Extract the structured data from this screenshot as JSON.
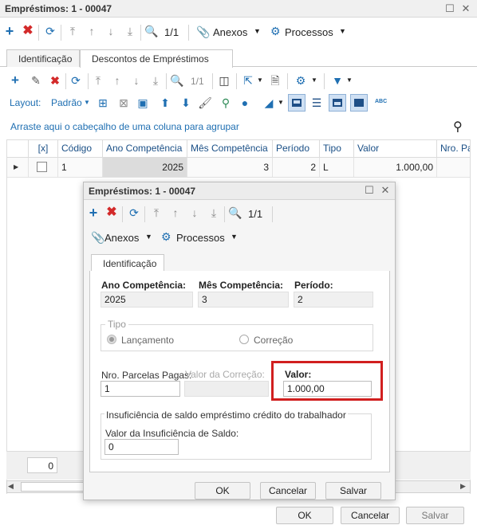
{
  "main": {
    "title": "Empréstimos: 1 - 00047",
    "toolbar": {
      "page": "1/1",
      "anexos": "Anexos",
      "processos": "Processos"
    },
    "tabs": [
      "Identificação",
      "Descontos de Empréstimos"
    ],
    "grid_toolbar": {
      "page": "1/1",
      "layout_label": "Layout:",
      "layout_value": "Padrão",
      "abc": "ABC"
    },
    "group_hint": "Arraste aqui o cabeçalho de uma coluna para agrupar",
    "columns": [
      "[x]",
      "Código",
      "Ano Competência",
      "Mês Competência",
      "Período",
      "Tipo",
      "Valor",
      "Nro. Pa"
    ],
    "row": {
      "codigo": "1",
      "ano": "2025",
      "mes": "3",
      "periodo": "2",
      "tipo": "L",
      "valor": "1.000,00"
    },
    "footer_count": "0",
    "buttons": {
      "ok": "OK",
      "cancel": "Cancelar",
      "save": "Salvar"
    }
  },
  "dialog": {
    "title": "Empréstimos: 1 - 00047",
    "toolbar": {
      "page": "1/1",
      "anexos": "Anexos",
      "processos": "Processos"
    },
    "tab": "Identificação",
    "fields": {
      "ano_label": "Ano Competência:",
      "ano": "2025",
      "mes_label": "Mês Competência:",
      "mes": "3",
      "periodo_label": "Período:",
      "periodo": "2"
    },
    "tipo": {
      "legend": "Tipo",
      "opt1": "Lançamento",
      "opt2": "Correção"
    },
    "parcelas_label": "Nro. Parcelas Pagas:",
    "parcelas": "1",
    "correcao_label": "Valor da Correção:",
    "valor_label": "Valor:",
    "valor": "1.000,00",
    "insuf": {
      "legend": "Insuficiência de saldo empréstimo crédito do trabalhador",
      "label": "Valor da Insuficiência de Saldo:",
      "value": "0"
    },
    "buttons": {
      "ok": "OK",
      "cancel": "Cancelar",
      "save": "Salvar"
    },
    "highlight_color": "#d11f1f"
  }
}
